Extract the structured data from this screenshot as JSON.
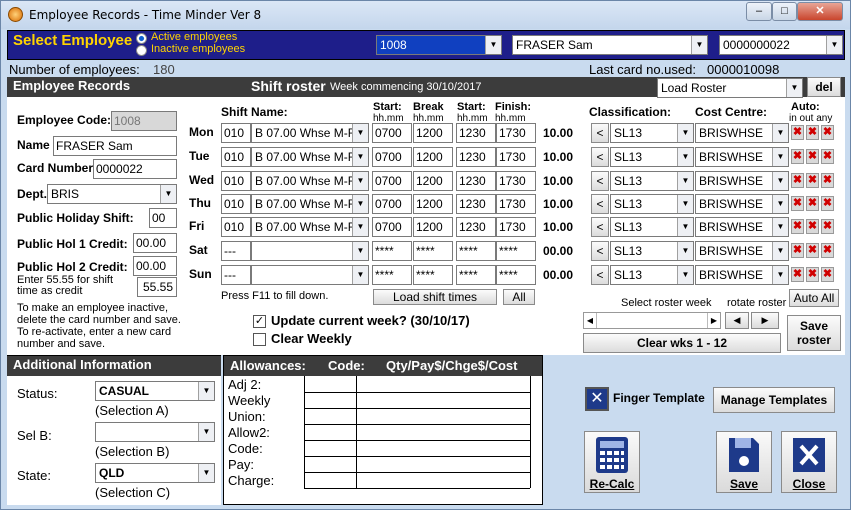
{
  "window": {
    "title": "Employee Records - Time Minder Ver 8",
    "minimize": "–",
    "maximize": "□",
    "close": "✕"
  },
  "top": {
    "label": "Select Employee",
    "radio_active": "Active employees",
    "radio_inactive": "Inactive employees",
    "emp_code": "1008",
    "emp_name": "FRASER Sam",
    "card": "0000000022"
  },
  "status": {
    "num_label": "Number of employees:",
    "num_value": "180",
    "last_card_label": "Last card no.used:",
    "last_card_value": "0000010098"
  },
  "left": {
    "header": "Employee Records",
    "code_label": "Employee Code:",
    "code_value": "1008",
    "name_label": "Name",
    "name_value": "FRASER Sam",
    "card_label": "Card Number",
    "card_value": "0000022",
    "dept_label": "Dept.",
    "dept_value": "BRIS",
    "ph_shift_label": "Public Holiday Shift:",
    "ph_shift_value": "00",
    "ph1_label": "Public Hol 1 Credit:",
    "ph1_value": "00.00",
    "ph2_label": "Public Hol 2 Credit:",
    "ph2_value": "00.00",
    "credit_note": "Enter 55.55 for shift time as credit",
    "credit_value": "55.55",
    "inactive_note": "To make an employee inactive, delete the card number and save. To re-activate, enter a new card number and save."
  },
  "roster": {
    "title": "Shift roster",
    "week": "Week commencing 30/10/2017",
    "load": "Load Roster",
    "del": "del",
    "h_shift": "Shift Name:",
    "h_start": "Start:",
    "h_break": "Break",
    "h_start2": "Start:",
    "h_finish": "Finish:",
    "h_hhmm": "hh.mm",
    "h_class": "Classification:",
    "h_cost": "Cost Centre:",
    "h_auto": "Auto:",
    "h_inout": "in out any",
    "days": [
      {
        "day": "Mon",
        "code": "010",
        "shift": "B 07.00 Whse M-F",
        "start": "0700",
        "brk": "1200",
        "start2": "1230",
        "finish": "1730",
        "hours": "10.00",
        "cls": "SL13",
        "cost": "BRISWHSE"
      },
      {
        "day": "Tue",
        "code": "010",
        "shift": "B 07.00 Whse M-F",
        "start": "0700",
        "brk": "1200",
        "start2": "1230",
        "finish": "1730",
        "hours": "10.00",
        "cls": "SL13",
        "cost": "BRISWHSE"
      },
      {
        "day": "Wed",
        "code": "010",
        "shift": "B 07.00 Whse M-F",
        "start": "0700",
        "brk": "1200",
        "start2": "1230",
        "finish": "1730",
        "hours": "10.00",
        "cls": "SL13",
        "cost": "BRISWHSE"
      },
      {
        "day": "Thu",
        "code": "010",
        "shift": "B 07.00 Whse M-F",
        "start": "0700",
        "brk": "1200",
        "start2": "1230",
        "finish": "1730",
        "hours": "10.00",
        "cls": "SL13",
        "cost": "BRISWHSE"
      },
      {
        "day": "Fri",
        "code": "010",
        "shift": "B 07.00 Whse M-F",
        "start": "0700",
        "brk": "1200",
        "start2": "1230",
        "finish": "1730",
        "hours": "10.00",
        "cls": "SL13",
        "cost": "BRISWHSE"
      },
      {
        "day": "Sat",
        "code": "---",
        "shift": "",
        "start": "****",
        "brk": "****",
        "start2": "****",
        "finish": "****",
        "hours": "00.00",
        "cls": "SL13",
        "cost": "BRISWHSE"
      },
      {
        "day": "Sun",
        "code": "---",
        "shift": "",
        "start": "****",
        "brk": "****",
        "start2": "****",
        "finish": "****",
        "hours": "00.00",
        "cls": "SL13",
        "cost": "BRISWHSE"
      }
    ],
    "f11": "Press F11 to fill down.",
    "load_times": "Load shift times",
    "all": "All",
    "update": "Update current week? (30/10/17)",
    "weekly": "Clear Weekly",
    "sel_week": "Select roster week",
    "rotate": "rotate roster",
    "auto_all": "Auto All",
    "clear_wks": "Clear wks 1 - 12",
    "save_roster": "Save roster",
    "x": "✖",
    "left_arrow": "<"
  },
  "additional": {
    "header": "Additional Information",
    "status_label": "Status:",
    "status_value": "CASUAL",
    "sel_a": "(Selection A)",
    "selb_label": "Sel B:",
    "selb_value": "",
    "sel_b": "(Selection B)",
    "state_label": "State:",
    "state_value": "QLD",
    "sel_c": "(Selection C)"
  },
  "allowances": {
    "h1": "Allowances:",
    "h2": "Code:",
    "h3": "Qty/Pay$/Chge$/Cost",
    "rows": [
      "Adj 2:",
      "Weekly",
      "Union:",
      "Allow2:",
      "Code:",
      "Pay:",
      "Charge:"
    ]
  },
  "actions": {
    "finger": "Finger Template",
    "manage": "Manage Templates",
    "recalc": "Re-Calc",
    "save": "Save",
    "close": "Close"
  }
}
